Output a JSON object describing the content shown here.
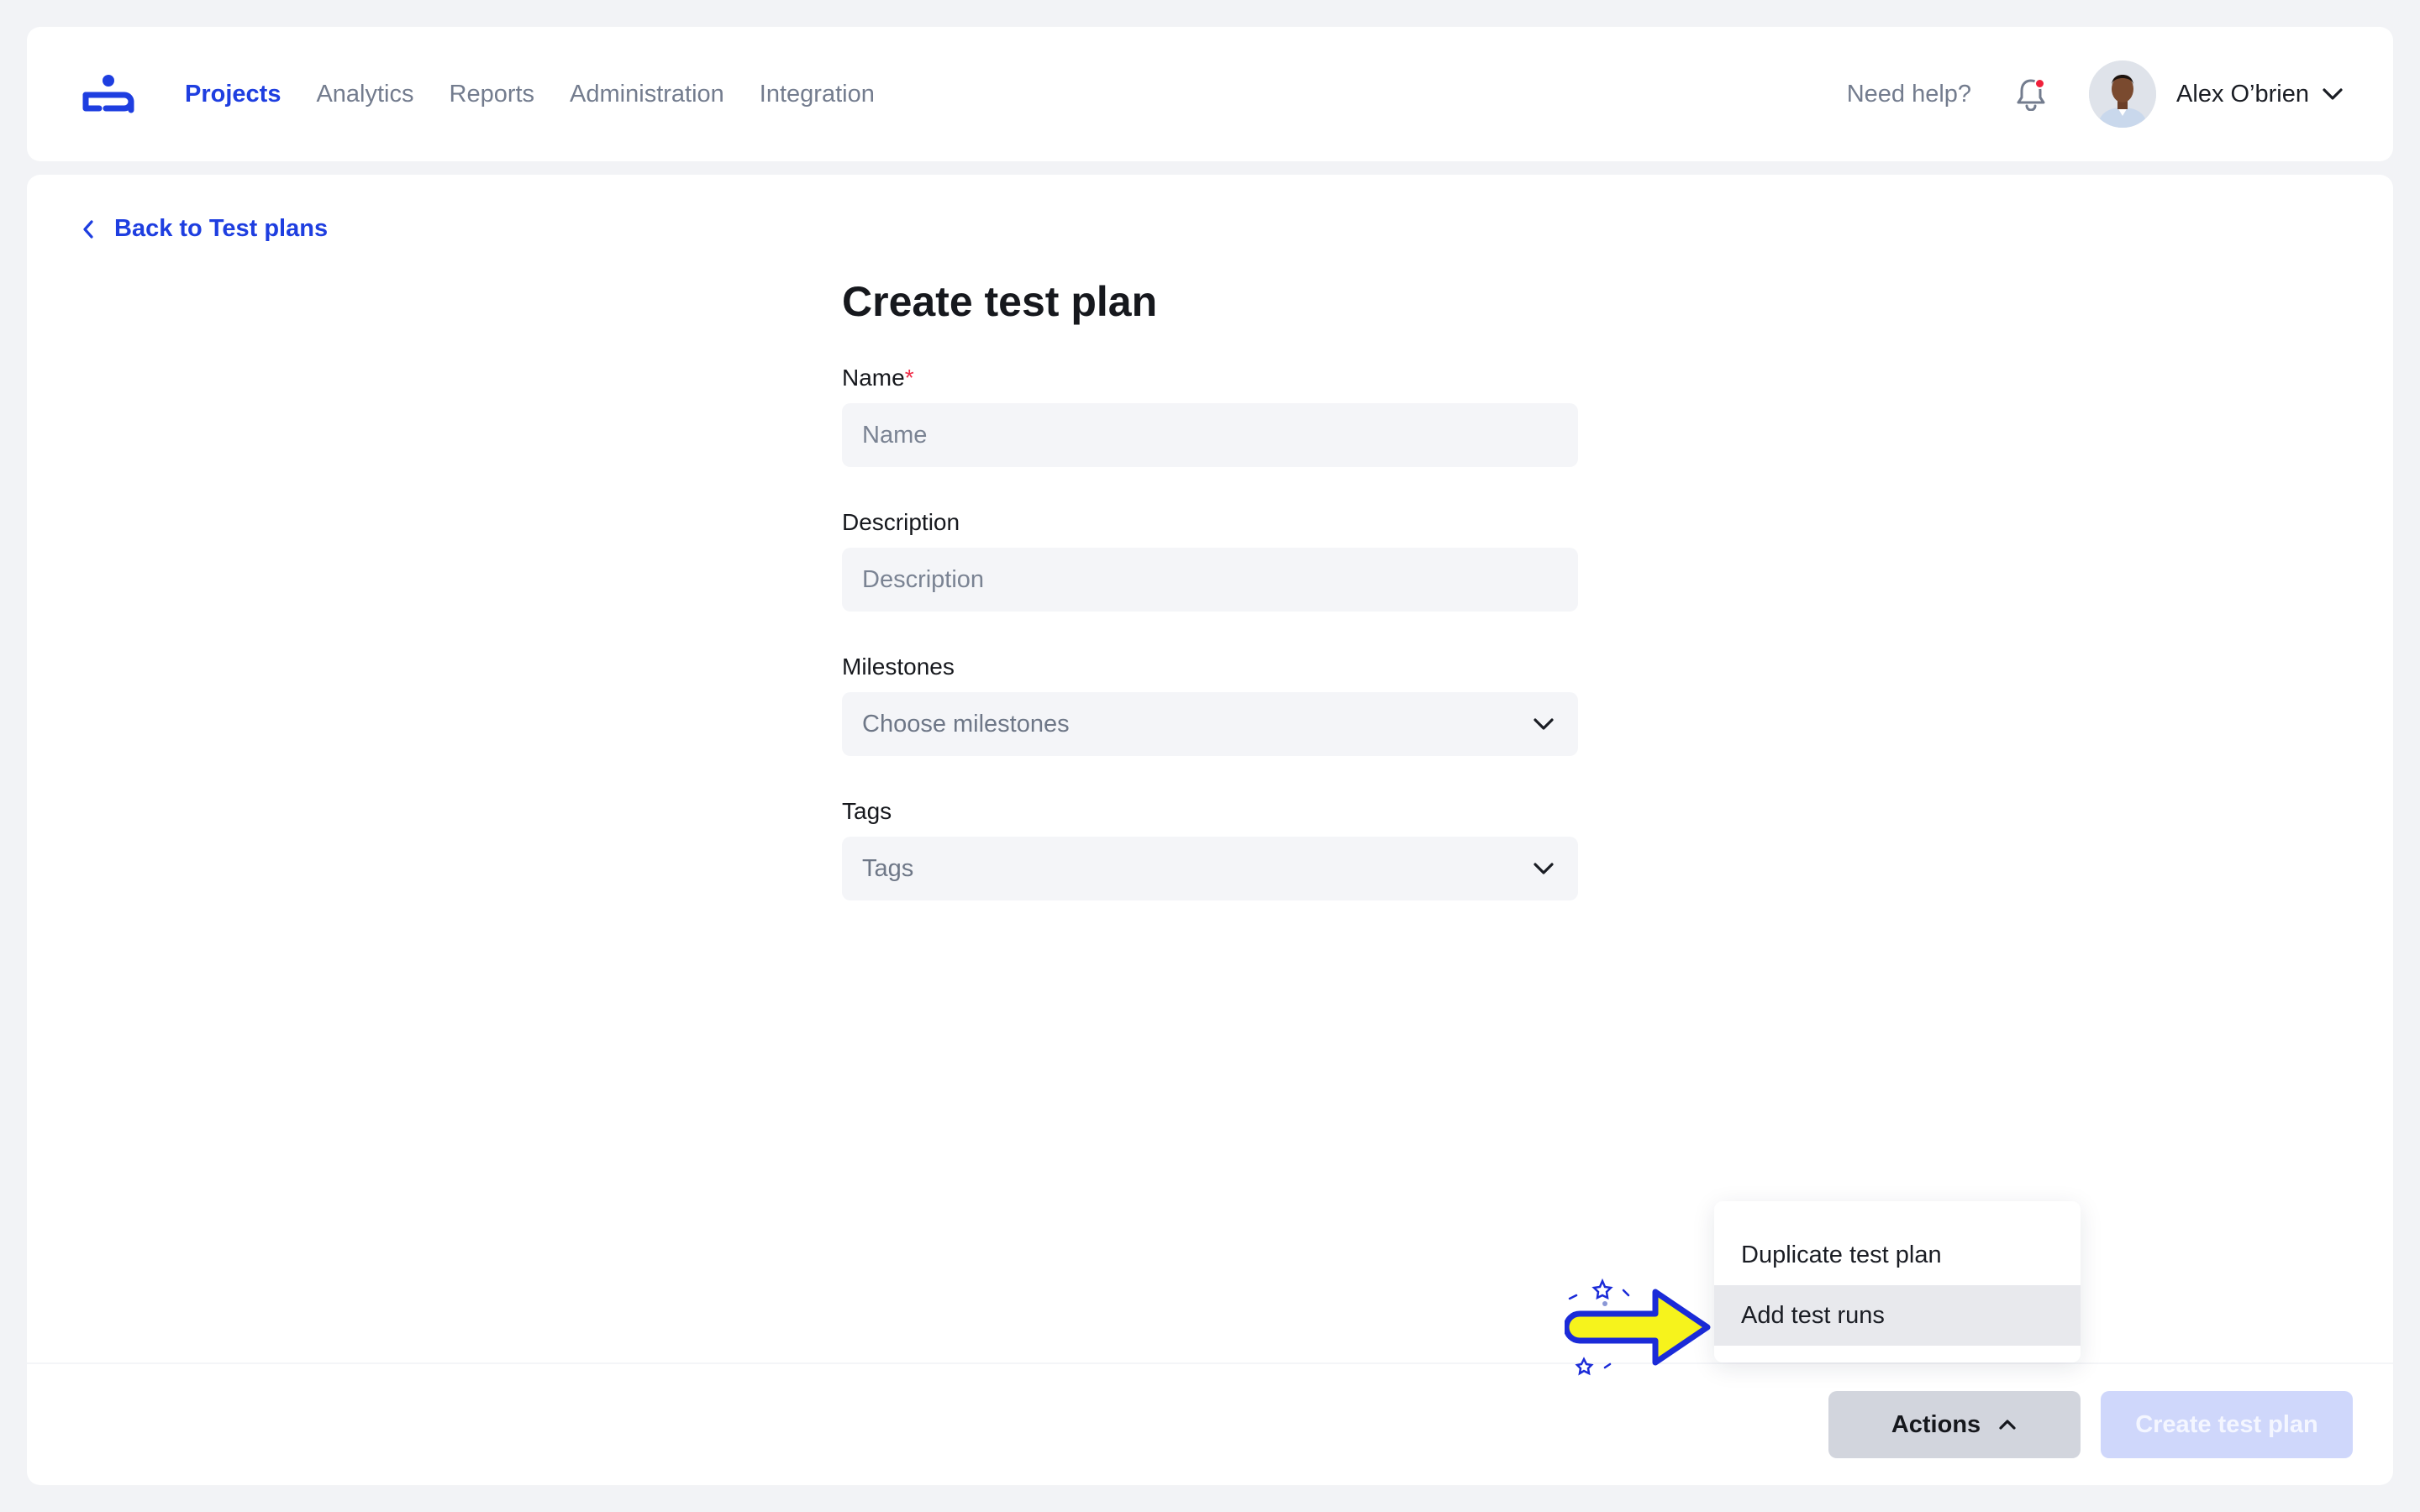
{
  "header": {
    "logo_icon": "user-stack-logo-icon",
    "nav": [
      {
        "label": "Projects",
        "active": true
      },
      {
        "label": "Analytics",
        "active": false
      },
      {
        "label": "Reports",
        "active": false
      },
      {
        "label": "Administration",
        "active": false
      },
      {
        "label": "Integration",
        "active": false
      }
    ],
    "help_label": "Need help?",
    "notification_icon": "bell-icon",
    "has_unread_notifications": true,
    "user": {
      "name": "Alex O’brien",
      "avatar_icon": "avatar"
    }
  },
  "back_link": {
    "label": "Back to Test plans",
    "icon": "chevron-left-icon"
  },
  "form": {
    "title": "Create test plan",
    "name": {
      "label": "Name",
      "required_mark": "*",
      "placeholder": "Name",
      "value": ""
    },
    "description": {
      "label": "Description",
      "placeholder": "Description",
      "value": ""
    },
    "milestones": {
      "label": "Milestones",
      "placeholder": "Choose milestones"
    },
    "tags": {
      "label": "Tags",
      "placeholder": "Tags"
    }
  },
  "actions_menu": {
    "open": true,
    "items": [
      {
        "label": "Duplicate test plan",
        "highlighted": false
      },
      {
        "label": "Add test runs",
        "highlighted": true
      }
    ]
  },
  "footer": {
    "actions_label": "Actions",
    "create_label": "Create test plan",
    "create_enabled": false
  },
  "colors": {
    "accent": "#1e3ee0",
    "required": "#ef2d48",
    "page_bg": "#f2f3f6",
    "annotation_arrow_fill": "#f6f31c",
    "annotation_arrow_stroke": "#1b2bd8"
  }
}
